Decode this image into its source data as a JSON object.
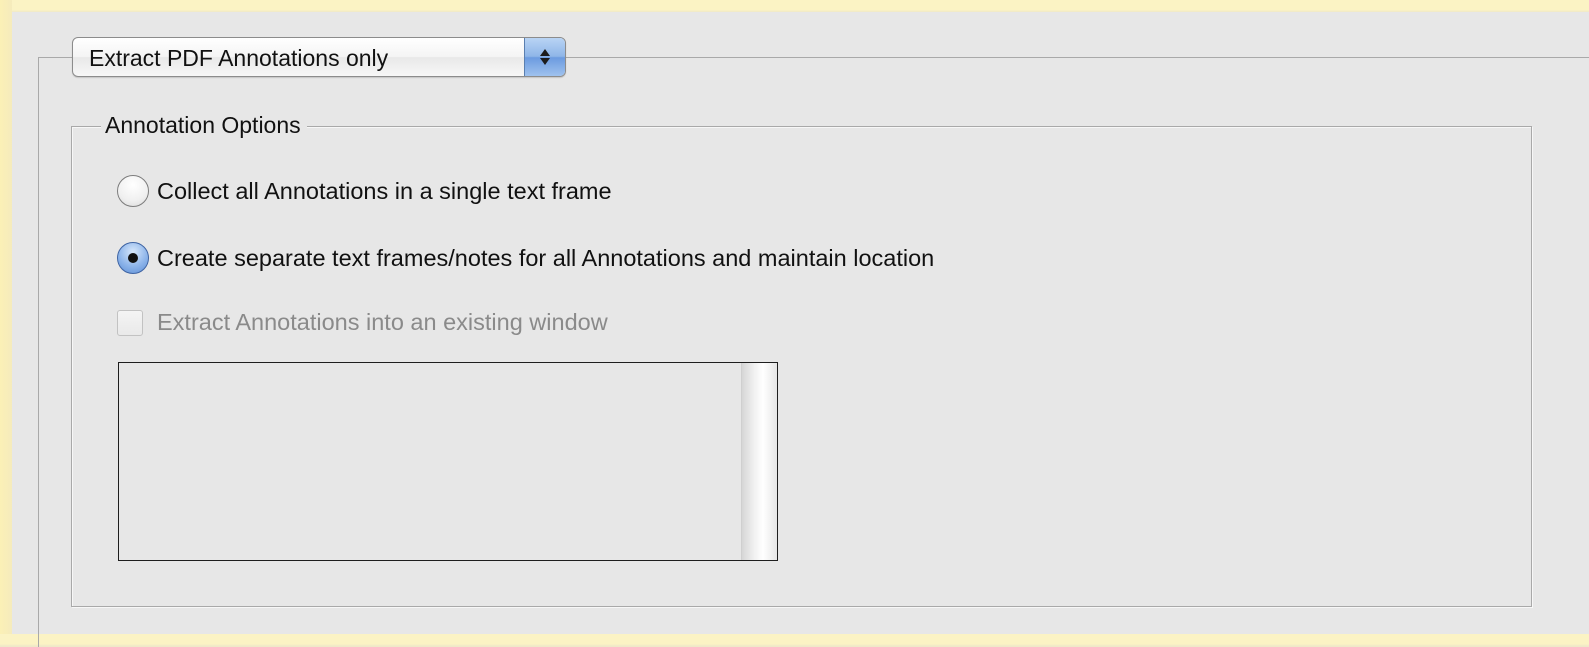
{
  "mode_popup": {
    "selected": "Extract PDF Annotations only",
    "icon": "up-down-arrows-icon"
  },
  "annotation_options": {
    "legend": "Annotation Options",
    "radio_collect": {
      "label": "Collect all Annotations in a single text frame",
      "checked": false
    },
    "radio_separate": {
      "label": "Create separate text frames/notes for all Annotations and maintain location",
      "checked": true
    },
    "checkbox_existing_window": {
      "label": "Extract Annotations into an existing window",
      "checked": false,
      "enabled": false
    },
    "window_list": {
      "items": []
    }
  },
  "colors": {
    "panel_background": "#e7e7e7",
    "popup_accent": "#8fb6e8",
    "background_edge": "#fbf3c4"
  }
}
